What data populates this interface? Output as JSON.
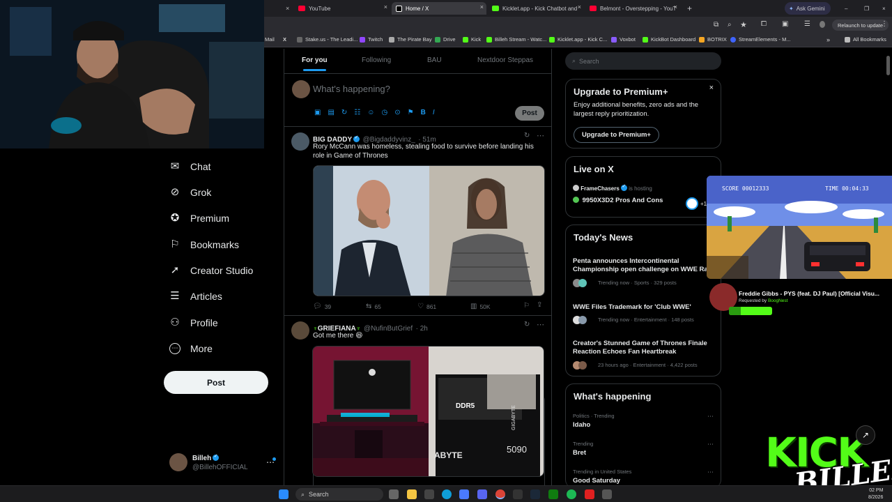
{
  "browser": {
    "tabs": [
      {
        "label": "YouTube",
        "fav": "#ff0033"
      },
      {
        "label": "Home / X",
        "fav": "#ffffff"
      },
      {
        "label": "Kicklet.app - Kick Chatbot and",
        "fav": "#53fc18"
      },
      {
        "label": "Belmont - Overstepping - YouT",
        "fav": "#ff0033"
      }
    ],
    "new_tab": "+",
    "gemini": "Ask Gemini",
    "relaunch": "Relaunch to update",
    "bookmarks": [
      "Mail",
      "X",
      "Stake.us - The Leadi...",
      "Twitch",
      "The Pirate Bay",
      "Drive",
      "Kick",
      "Billeh Stream - Watc...",
      "Kicklet.app - Kick C...",
      "Voxbot",
      "KickBot Dashboard",
      "BOTRIX",
      "StreamElements - M..."
    ],
    "all_bookmarks": "All Bookmarks"
  },
  "nav": {
    "items": [
      {
        "label": "Chat",
        "icon": "mail-icon",
        "glyph": "✉"
      },
      {
        "label": "Grok",
        "icon": "grok-icon",
        "glyph": "⊘"
      },
      {
        "label": "Premium",
        "icon": "premium-icon",
        "glyph": "✪"
      },
      {
        "label": "Bookmarks",
        "icon": "bookmark-icon",
        "glyph": "⚐"
      },
      {
        "label": "Creator Studio",
        "icon": "rocket-icon",
        "glyph": "➚"
      },
      {
        "label": "Articles",
        "icon": "articles-icon",
        "glyph": "☰"
      },
      {
        "label": "Profile",
        "icon": "profile-icon",
        "glyph": "⚇"
      },
      {
        "label": "More",
        "icon": "more-icon",
        "glyph": "⋯"
      }
    ],
    "post": "Post",
    "account": {
      "name": "Billeh",
      "handle": "@BillehOFFICIAL"
    }
  },
  "feed": {
    "tabs": [
      "For you",
      "Following",
      "BAU",
      "Nextdoor Steppas"
    ],
    "composer_placeholder": "What's happening?",
    "composer_post": "Post",
    "tweets": [
      {
        "name": "BIG DADDY",
        "handle": "@Bigdaddyvinz_",
        "time": "· 51m",
        "text": "Rory McCann was homeless, stealing food to survive before landing his role in Game of Thrones",
        "replies": "39",
        "reposts": "65",
        "likes": "861",
        "views": "50K"
      },
      {
        "name": "GRIEFIANA",
        "handle": "@NufinButGrief",
        "time": "· 2h",
        "text": "Got me there 😆",
        "image_texts": [
          "DDR5",
          "5090",
          "GIGABYTE",
          "ABYTE"
        ]
      }
    ]
  },
  "sidebar": {
    "search_placeholder": "Search",
    "premium": {
      "title": "Upgrade to Premium+",
      "body": "Enjoy additional benefits, zero ads and the largest reply prioritization.",
      "button": "Upgrade to Premium+"
    },
    "live": {
      "title": "Live on X",
      "host": "FrameChasers",
      "hosting": "is hosting",
      "space": "9950X3D2 Pros And Cons",
      "count": "+1"
    },
    "news": {
      "title": "Today's News",
      "items": [
        {
          "title": "Penta announces Intercontinental Championship open challenge on WWE Ra",
          "meta": "Trending now · Sports · 329 posts"
        },
        {
          "title": "WWE Files Trademark for 'Club WWE'",
          "meta": "Trending now · Entertainment · 148 posts"
        },
        {
          "title": "Creator's Stunned Game of Thrones Finale Reaction Echoes Fan Heartbreak",
          "meta": "23 hours ago · Entertainment · 4,422 posts"
        }
      ]
    },
    "happening": {
      "title": "What's happening",
      "items": [
        {
          "cat": "Politics · Trending",
          "name": "Idaho"
        },
        {
          "cat": "Trending",
          "name": "Bret"
        },
        {
          "cat": "Trending in United States",
          "name": "Good Saturday"
        }
      ]
    }
  },
  "overlay": {
    "score": "SCORE 00012333",
    "time": "TIME 00:04:33",
    "song": "Freddie Gibbs - PYS (feat. DJ Paul) [Official Visu...",
    "requested": "Requested by",
    "requester": "BoogNest",
    "kick": "KICK",
    "billeh": "BILLEH"
  },
  "taskbar": {
    "search": "Search",
    "time": "02 PM",
    "date": "8/2026"
  },
  "colors": {
    "accent": "#1d9bf0",
    "kick": "#53fc18",
    "bg": "#000000"
  }
}
